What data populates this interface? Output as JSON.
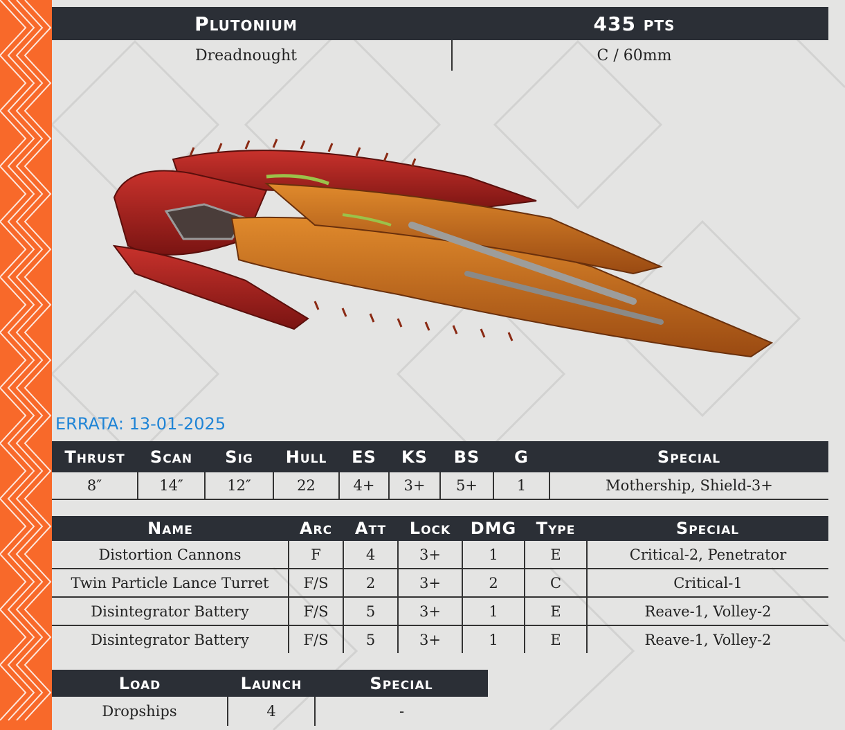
{
  "header": {
    "name": "Plutonium",
    "points": "435 pts",
    "class": "Dreadnought",
    "base": "C / 60mm"
  },
  "errata": "ERRATA: 13-01-2025",
  "stats": {
    "headers": [
      "Thrust",
      "Scan",
      "Sig",
      "Hull",
      "ES",
      "KS",
      "BS",
      "G",
      "Special"
    ],
    "values": [
      "8″",
      "14″",
      "12″",
      "22",
      "4+",
      "3+",
      "5+",
      "1",
      "Mothership, Shield-3+"
    ]
  },
  "weapons": {
    "headers": [
      "Name",
      "Arc",
      "Att",
      "Lock",
      "DMG",
      "Type",
      "Special"
    ],
    "rows": [
      [
        "Distortion Cannons",
        "F",
        "4",
        "3+",
        "1",
        "E",
        "Critical-2, Penetrator"
      ],
      [
        "Twin Particle Lance Turret",
        "F/S",
        "2",
        "3+",
        "2",
        "C",
        "Critical-1"
      ],
      [
        "Disintegrator Battery",
        "F/S",
        "5",
        "3+",
        "1",
        "E",
        "Reave-1, Volley-2"
      ],
      [
        "Disintegrator Battery",
        "F/S",
        "5",
        "3+",
        "1",
        "E",
        "Reave-1, Volley-2"
      ]
    ]
  },
  "launch": {
    "headers": [
      "Load",
      "Launch",
      "Special"
    ],
    "values": [
      "Dropships",
      "4",
      "-"
    ]
  },
  "colors": {
    "accent_stripe": "#f8692a",
    "header_bg": "#2b2f36",
    "errata_blue": "#1f84d6"
  }
}
